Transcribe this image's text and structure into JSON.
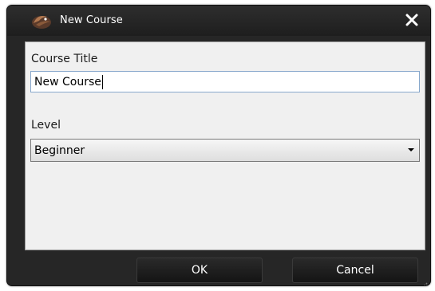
{
  "window": {
    "title": "New Course",
    "icon": "app-logo-icon",
    "close_icon": "close-icon"
  },
  "form": {
    "course_title_label": "Course Title",
    "course_title_value": "New Course",
    "level_label": "Level",
    "level_value": "Beginner"
  },
  "buttons": {
    "ok_label": "OK",
    "cancel_label": "Cancel"
  },
  "colors": {
    "frame": "#262626",
    "content_bg": "#f0f0f0",
    "input_border": "#88a8cc"
  }
}
